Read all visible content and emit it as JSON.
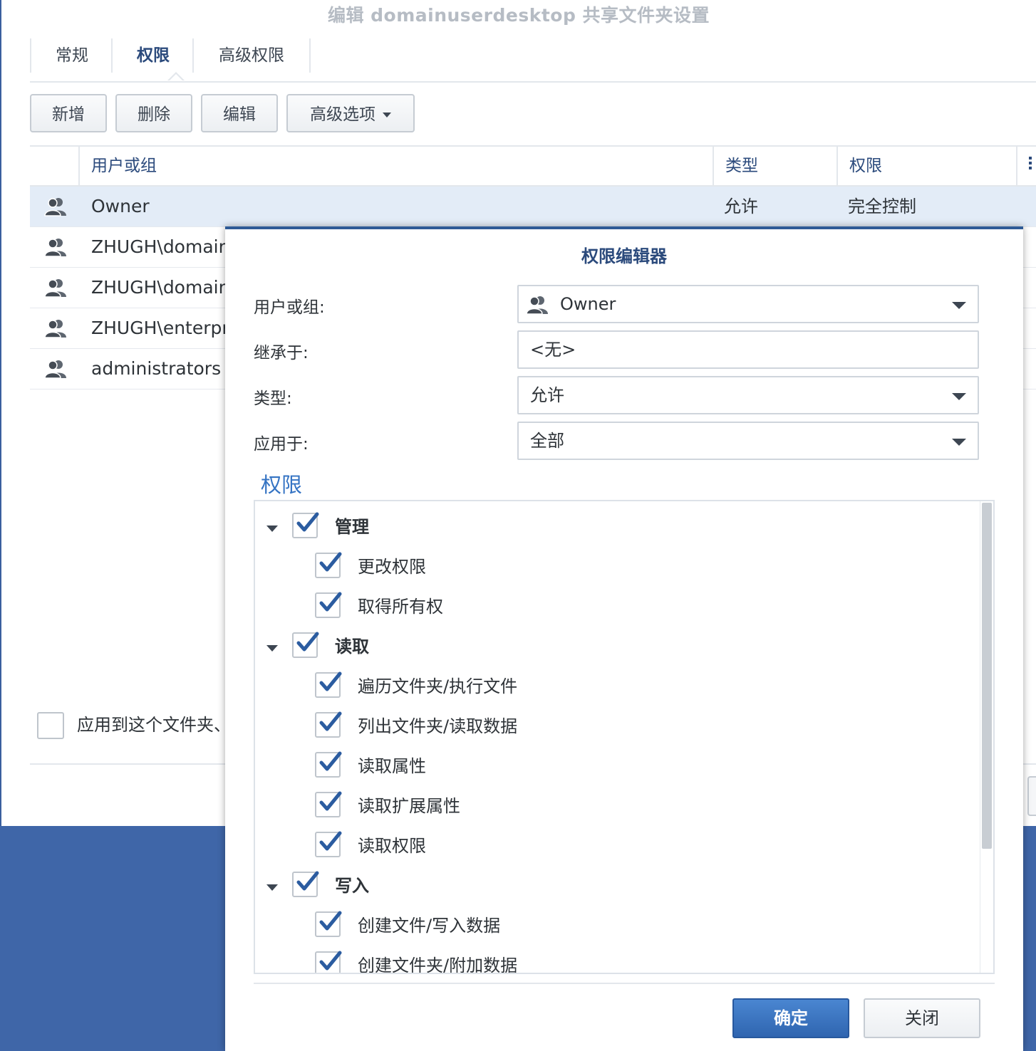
{
  "window": {
    "title": "编辑 domainuserdesktop 共享文件夹设置",
    "tabs": [
      {
        "label": "常规"
      },
      {
        "label": "权限"
      },
      {
        "label": "高级权限"
      }
    ]
  },
  "toolbar": {
    "add_label": "新增",
    "delete_label": "删除",
    "edit_label": "编辑",
    "advanced_label": "高级选项"
  },
  "table": {
    "columns": [
      "用户或组",
      "类型",
      "权限"
    ],
    "rows": [
      {
        "name": "Owner",
        "type": "允许",
        "permission": "完全控制"
      },
      {
        "name": "ZHUGH\\domain",
        "type": "",
        "permission": ""
      },
      {
        "name": "ZHUGH\\domain",
        "type": "",
        "permission": ""
      },
      {
        "name": "ZHUGH\\enterpr",
        "type": "",
        "permission": ""
      },
      {
        "name": "administrators",
        "type": "",
        "permission": ""
      }
    ]
  },
  "apply_option": {
    "label": "应用到这个文件夹、",
    "checked": false
  },
  "dialog": {
    "title": "权限编辑器",
    "user_label": "用户或组:",
    "user_value": "Owner",
    "inherit_label": "继承于:",
    "inherit_value": "<无>",
    "type_label": "类型:",
    "type_value": "允许",
    "apply_label": "应用于:",
    "apply_value": "全部",
    "permissions_title": "权限",
    "tree": [
      {
        "label": "管理",
        "level": 0,
        "checked": true
      },
      {
        "label": "更改权限",
        "level": 1,
        "checked": true
      },
      {
        "label": "取得所有权",
        "level": 1,
        "checked": true
      },
      {
        "label": "读取",
        "level": 0,
        "checked": true
      },
      {
        "label": "遍历文件夹/执行文件",
        "level": 1,
        "checked": true
      },
      {
        "label": "列出文件夹/读取数据",
        "level": 1,
        "checked": true
      },
      {
        "label": "读取属性",
        "level": 1,
        "checked": true
      },
      {
        "label": "读取扩展属性",
        "level": 1,
        "checked": true
      },
      {
        "label": "读取权限",
        "level": 1,
        "checked": true
      },
      {
        "label": "写入",
        "level": 0,
        "checked": true
      },
      {
        "label": "创建文件/写入数据",
        "level": 1,
        "checked": true
      },
      {
        "label": "创建文件夹/附加数据",
        "level": 1,
        "checked": true
      }
    ],
    "ok_label": "确定",
    "close_label": "关闭"
  },
  "colors": {
    "accent": "#2f65b0",
    "check": "#2b5ca0",
    "desktop": "#3f66a8"
  }
}
